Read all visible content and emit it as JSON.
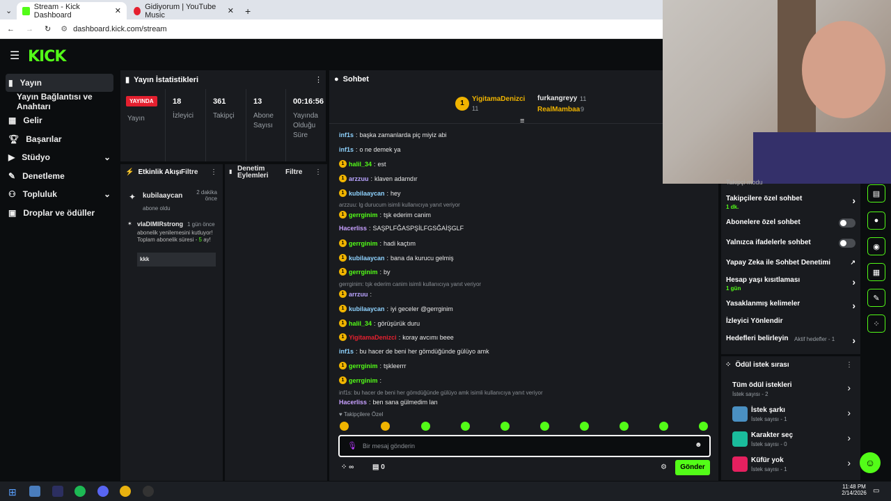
{
  "browser": {
    "tab1": "Stream - Kick Dashboard",
    "tab2": "Gidiyorum | YouTube Music",
    "url": "dashboard.kick.com/stream"
  },
  "sidebar": {
    "items": [
      {
        "label": "Yayın"
      },
      {
        "label": "Yayın Bağlantısı ve Anahtarı"
      },
      {
        "label": "Gelir"
      },
      {
        "label": "Başarılar"
      },
      {
        "label": "Stüdyo"
      },
      {
        "label": "Denetleme"
      },
      {
        "label": "Topluluk"
      },
      {
        "label": "Droplar ve ödüller"
      }
    ]
  },
  "stats": {
    "title": "Yayın İstatistikleri",
    "live": "YAYINDA",
    "live_label": "Yayın",
    "viewers": "18",
    "viewers_label": "İzleyici",
    "followers": "361",
    "followers_label": "Takipçi",
    "subs": "13",
    "subs_label": "Abone Sayısı",
    "duration": "00:16:56",
    "duration_label": "Yayında Olduğu Süre"
  },
  "activity": {
    "title": "Etkinlik Akışı",
    "filter": "Filtre",
    "e1_user": "kubilaaycan",
    "e1_time": "2 dakika önce",
    "e1_desc": "abone oldu",
    "e2_user": "vlaDIMIRstrong",
    "e2_time": "1 gün önce",
    "e2_desc": "abonelik yenilemesini kutluyor! Toplam abonelik süresi -",
    "e2_months": "5",
    "e2_suffix": "ay!",
    "e2_msg": "kkk"
  },
  "moderation": {
    "title": "Denetim Eylemleri",
    "filter": "Filtre"
  },
  "chat": {
    "title": "Sohbet",
    "top1_name": "YigitamaDenizci",
    "top1_count": "11",
    "top2_name": "furkangreyy",
    "top2_count": "11",
    "top3_name": "RealMambaa",
    "top3_count": "9",
    "lines": [
      {
        "user": "inf1s",
        "text": "başka zamanlarda piç miyiz abi"
      },
      {
        "user": "inf1s",
        "text": "o ne demek ya"
      },
      {
        "user": "halil_34",
        "text": "est"
      },
      {
        "user": "arzzuu",
        "text": "klaven adamdır"
      },
      {
        "user": "kubilaaycan",
        "text": "hey"
      },
      {
        "reply": "arzzuu: lg durucum isimli kullanıcıya yanıt veriyor"
      },
      {
        "user": "gerrginim",
        "text": "tşk ederim canim"
      },
      {
        "user": "Hacerliss",
        "text": "SAŞPLFĞASPŞİLFGSĞAİŞGLF"
      },
      {
        "user": "gerrginim",
        "text": "hadi kaçtım"
      },
      {
        "user": "kubilaaycan",
        "text": "bana da kurucu gelmiş"
      },
      {
        "user": "gerrginim",
        "text": "by"
      },
      {
        "reply": "gerrginim: tşk ederim canim isimli kullanıcıya yanıt veriyor"
      },
      {
        "user": "arrzuu",
        "text": ""
      },
      {
        "user": "kubilaaycan",
        "text": "iyi geceler @gerrginim"
      },
      {
        "user": "halil_34",
        "text": "görüşürük duru"
      },
      {
        "user": "YigitamaDenizci",
        "text": "koray avcımı beee"
      },
      {
        "user": "inf1s",
        "text": "bu hacer de beni her gömdüğünde gülüyo amk"
      },
      {
        "user": "gerrginim",
        "text": "tşkleerrr"
      },
      {
        "user": "gerrginim",
        "text": ""
      },
      {
        "reply": "inf1s: bu hacer de beni her gömdüğünde gülüyo amk isimli kullanıcıya yanıt veriyor"
      },
      {
        "user": "Hacerliss",
        "text": "ben sana gülmedim lan"
      }
    ],
    "followers_only": "Takipçilere Özel",
    "placeholder": "Bir mesaj gönderin",
    "send": "Gönder",
    "points": "∞",
    "gifts": "0"
  },
  "settings": {
    "partial": "Takipçi modu",
    "items": [
      {
        "label": "Takipçilere özel sohbet",
        "sub": "1 dk."
      },
      {
        "label": "Abonelere özel sohbet"
      },
      {
        "label": "Yalnızca ifadelerle sohbet"
      },
      {
        "label": "Yapay Zeka ile Sohbet Denetimi"
      },
      {
        "label": "Hesap yaşı kısıtlaması",
        "sub": "1 gün"
      },
      {
        "label": "Yasaklanmış kelimeler"
      },
      {
        "label": "İzleyici Yönlendir"
      },
      {
        "label": "Hedefleri belirleyin",
        "sub": "Aktif hedefler - 1"
      }
    ]
  },
  "rewards": {
    "title": "Ödül istek sırası",
    "items": [
      {
        "title": "Tüm ödül istekleri",
        "sub": "İstek sayısı - 2"
      },
      {
        "title": "İstek şarkı",
        "sub": "İstek sayısı - 1"
      },
      {
        "title": "Karakter seç",
        "sub": "İstek sayısı - 0"
      },
      {
        "title": "Küfür yok",
        "sub": "İstek sayısı - 1"
      }
    ]
  },
  "taskbar": {
    "time": "11:48 PM",
    "date": "2/14/2026"
  },
  "colors": {
    "kick_green": "#53fc18",
    "live_red": "#e5202f"
  }
}
